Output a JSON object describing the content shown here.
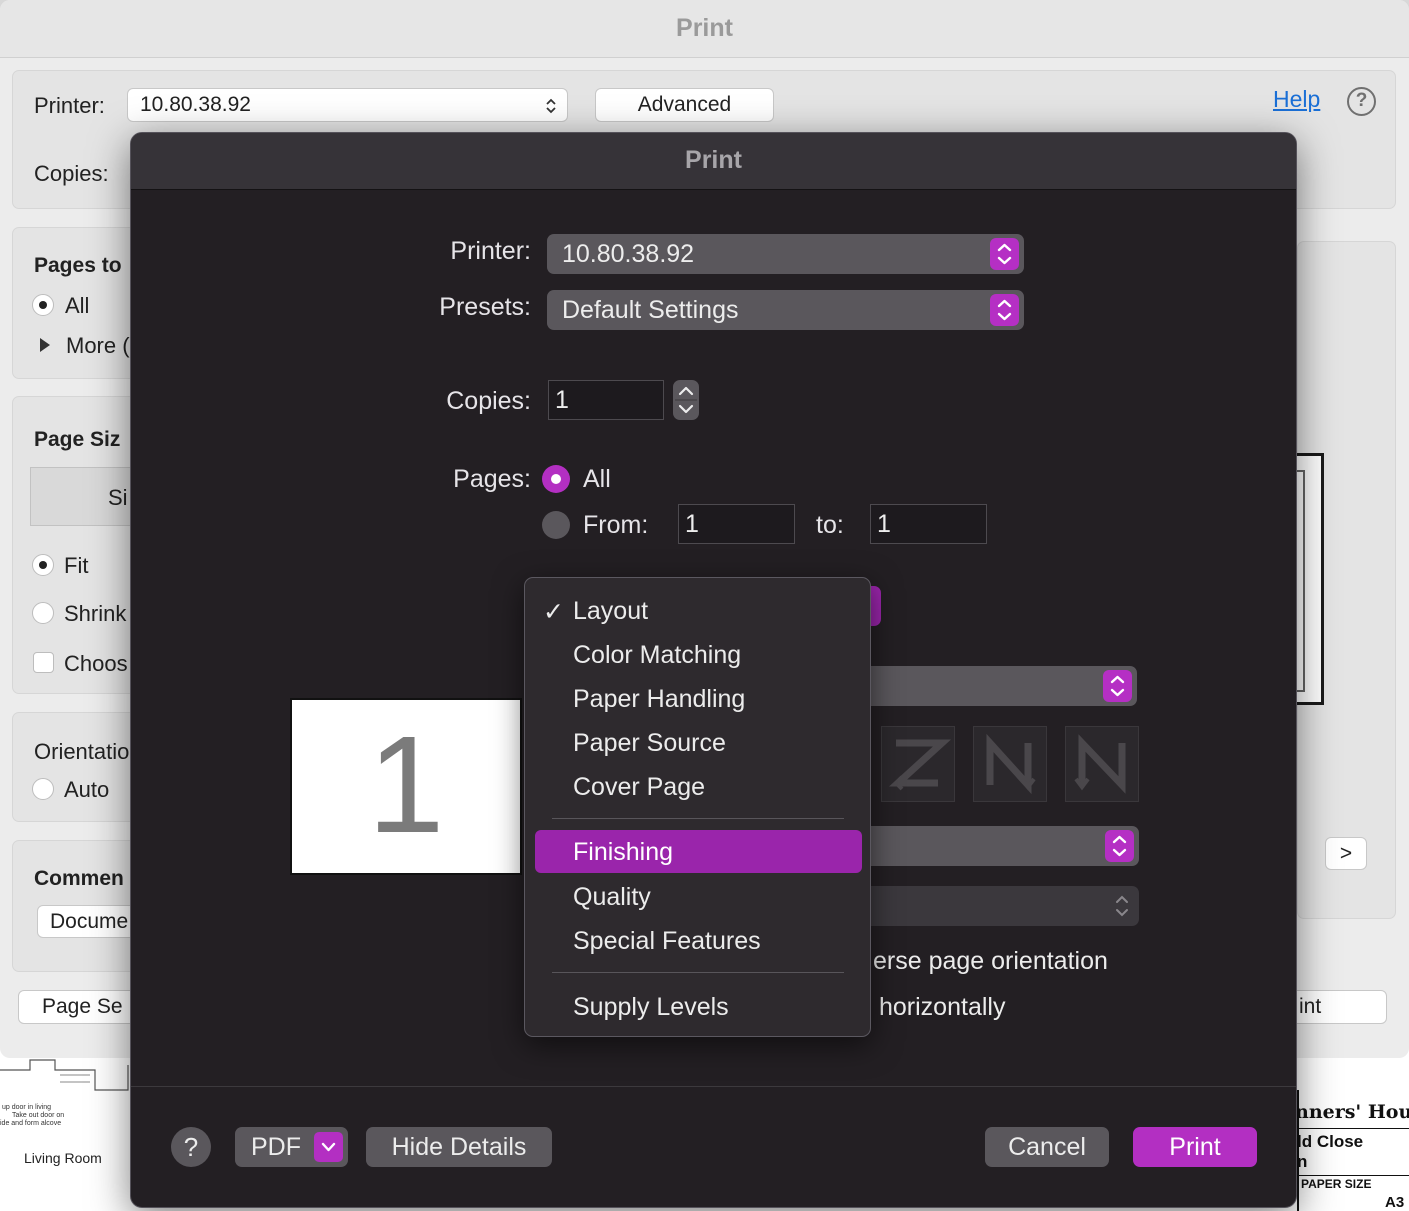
{
  "back_window": {
    "title": "Print",
    "printer_label": "Printer:",
    "printer_value": "10.80.38.92",
    "advanced_label": "Advanced",
    "help_label": "Help",
    "help_icon_glyph": "?",
    "copies_label": "Copies:",
    "pages_to_print_heading": "Pages to",
    "all_label": "All",
    "more_options_label": "More (",
    "page_size_heading": "Page Siz",
    "size_button_label": "Si",
    "fit_label": "Fit",
    "shrink_label": "Shrink",
    "choose_label": "Choos",
    "orientation_heading": "Orientatio",
    "auto_label": "Auto",
    "comments_heading": "Commen",
    "comments_value": "Docume",
    "page_setup_label": "Page Se",
    "next_label": ">",
    "print_partial_label": "int"
  },
  "blueprint": {
    "note_lines": [
      "up door in living",
      "Take out door on",
      "ide and form alcove"
    ],
    "living_room": "Living Room",
    "owners_house": "nners' Hou",
    "close": "ld Close",
    "n": "n",
    "paper_size": "PAPER SIZE",
    "a3": "A3"
  },
  "sheet": {
    "title": "Print",
    "printer_label": "Printer:",
    "printer_value": "10.80.38.92",
    "presets_label": "Presets:",
    "presets_value": "Default Settings",
    "copies_label": "Copies:",
    "copies_value": "1",
    "pages_label": "Pages:",
    "pages_all_label": "All",
    "pages_from_label": "From:",
    "pages_from_value": "1",
    "pages_to_label": "to:",
    "pages_to_value": "1",
    "preview_page_number": "1",
    "reverse_orientation_text": "erse page orientation",
    "flip_horizontally_text": "horizontally",
    "footer": {
      "help_glyph": "?",
      "pdf_label": "PDF",
      "hide_details_label": "Hide Details",
      "cancel_label": "Cancel",
      "print_label": "Print"
    }
  },
  "section_menu": {
    "checkmark": "✓",
    "selected": "Layout",
    "highlighted": "Finishing",
    "groups": [
      [
        "Layout",
        "Color Matching",
        "Paper Handling",
        "Paper Source",
        "Cover Page"
      ],
      [
        "Finishing",
        "Quality",
        "Special Features"
      ],
      [
        "Supply Levels"
      ]
    ]
  },
  "colors": {
    "accent": "#b32fc2",
    "sheet_background": "#231f23",
    "menu_highlight": "#9a25ab",
    "link": "#1a6fd6"
  }
}
